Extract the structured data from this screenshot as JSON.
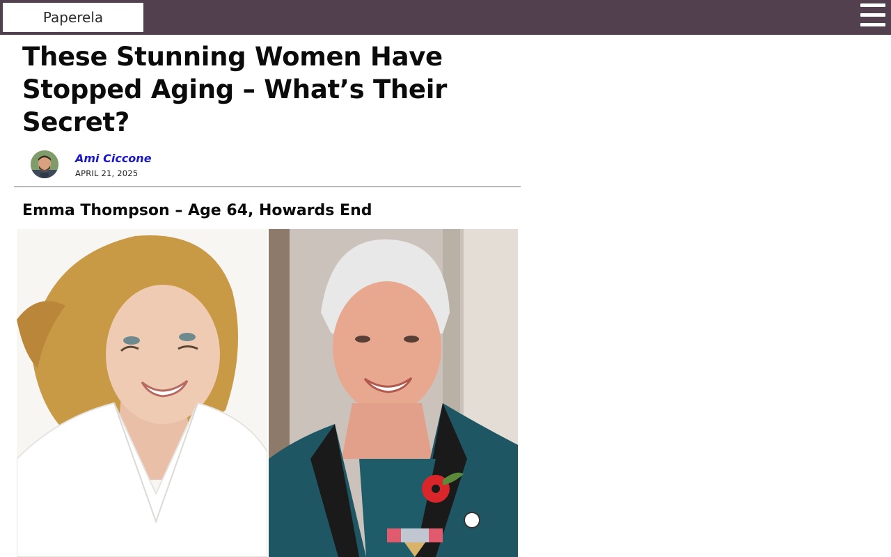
{
  "header": {
    "site_name": "Paperela",
    "menu_icon": "hamburger-menu-icon",
    "background_color": "#53404e"
  },
  "article": {
    "title": "These Stunning Women Have Stopped Aging – What’s Their Secret?",
    "author": {
      "name": "Ami Ciccone",
      "color": "#1a16c9"
    },
    "date": "APRIL 21, 2025",
    "section": {
      "heading": "Emma Thompson – Age 64, Howards End"
    }
  }
}
